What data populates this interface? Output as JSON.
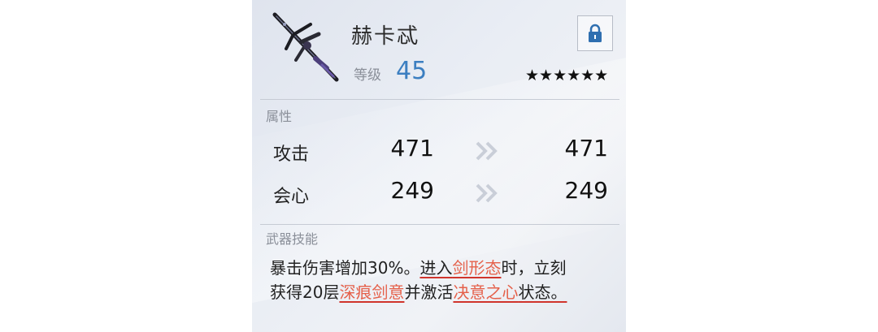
{
  "weapon": {
    "name": "赫卡忒",
    "level_label": "等级",
    "level_value": "45",
    "stars": "★★★★★★",
    "lock_icon": "lock-icon",
    "art_icon": "spear-weapon-icon"
  },
  "attributes": {
    "section_label": "属性",
    "rows": [
      {
        "name": "攻击",
        "old": "471",
        "new": "471"
      },
      {
        "name": "会心",
        "old": "249",
        "new": "249"
      }
    ],
    "arrow_icon": "double-chevron-right-icon"
  },
  "skill": {
    "section_label": "武器技能",
    "parts": [
      "暴击伤害增加30%。",
      "进入",
      "剑形态",
      "时，立刻",
      "获得20层",
      "深痕剑意",
      "并激活",
      "决意之心",
      "状态。"
    ]
  },
  "colors": {
    "level_accent": "#3c7fc1",
    "highlight": "#e5604a",
    "underline": "#d0342c",
    "lock_blue": "#2f6fb0"
  }
}
